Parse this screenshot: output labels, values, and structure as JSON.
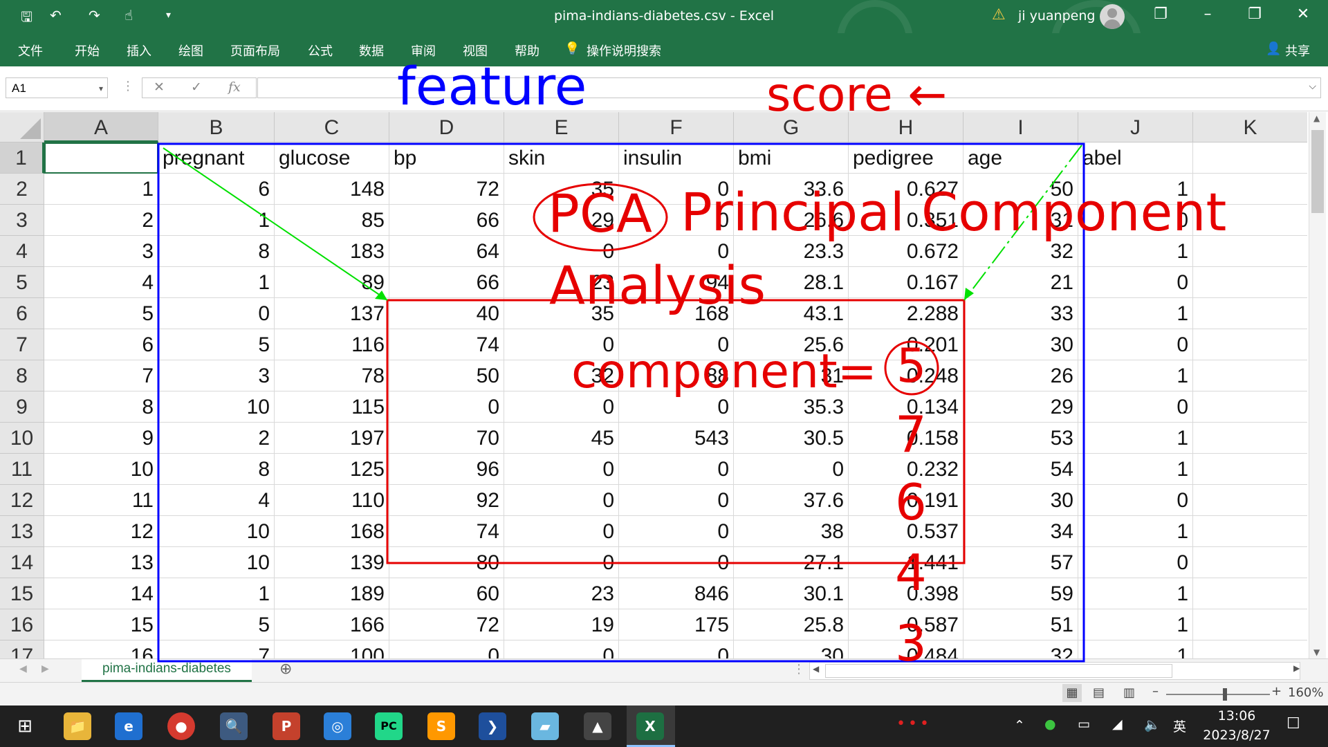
{
  "window": {
    "title": "pima-indians-diabetes.csv  -  Excel",
    "user": "ji yuanpeng",
    "warning_icon": "warning-icon",
    "theme_color": "#217346"
  },
  "ribbon": {
    "tabs": [
      "文件",
      "开始",
      "插入",
      "绘图",
      "页面布局",
      "公式",
      "数据",
      "审阅",
      "视图",
      "帮助"
    ],
    "search": "操作说明搜索",
    "share": "共享"
  },
  "formula_bar": {
    "name_box": "A1",
    "fx_label": "fx",
    "formula": ""
  },
  "columns": [
    "A",
    "B",
    "C",
    "D",
    "E",
    "F",
    "G",
    "H",
    "I",
    "J",
    "K"
  ],
  "header_row": [
    "",
    "pregnant",
    "glucose",
    "bp",
    "skin",
    "insulin",
    "bmi",
    "pedigree",
    "age",
    "abel",
    ""
  ],
  "rows": [
    [
      "1",
      "6",
      "148",
      "72",
      "35",
      "0",
      "33.6",
      "0.627",
      "50",
      "1"
    ],
    [
      "2",
      "1",
      "85",
      "66",
      "29",
      "0",
      "26.6",
      "0.351",
      "31",
      "0"
    ],
    [
      "3",
      "8",
      "183",
      "64",
      "0",
      "0",
      "23.3",
      "0.672",
      "32",
      "1"
    ],
    [
      "4",
      "1",
      "89",
      "66",
      "23",
      "94",
      "28.1",
      "0.167",
      "21",
      "0"
    ],
    [
      "5",
      "0",
      "137",
      "40",
      "35",
      "168",
      "43.1",
      "2.288",
      "33",
      "1"
    ],
    [
      "6",
      "5",
      "116",
      "74",
      "0",
      "0",
      "25.6",
      "0.201",
      "30",
      "0"
    ],
    [
      "7",
      "3",
      "78",
      "50",
      "32",
      "88",
      "31",
      "0.248",
      "26",
      "1"
    ],
    [
      "8",
      "10",
      "115",
      "0",
      "0",
      "0",
      "35.3",
      "0.134",
      "29",
      "0"
    ],
    [
      "9",
      "2",
      "197",
      "70",
      "45",
      "543",
      "30.5",
      "0.158",
      "53",
      "1"
    ],
    [
      "10",
      "8",
      "125",
      "96",
      "0",
      "0",
      "0",
      "0.232",
      "54",
      "1"
    ],
    [
      "11",
      "4",
      "110",
      "92",
      "0",
      "0",
      "37.6",
      "0.191",
      "30",
      "0"
    ],
    [
      "12",
      "10",
      "168",
      "74",
      "0",
      "0",
      "38",
      "0.537",
      "34",
      "1"
    ],
    [
      "13",
      "10",
      "139",
      "80",
      "0",
      "0",
      "27.1",
      "1.441",
      "57",
      "0"
    ],
    [
      "14",
      "1",
      "189",
      "60",
      "23",
      "846",
      "30.1",
      "0.398",
      "59",
      "1"
    ],
    [
      "15",
      "5",
      "166",
      "72",
      "19",
      "175",
      "25.8",
      "0.587",
      "51",
      "1"
    ],
    [
      "16",
      "7",
      "100",
      "0",
      "0",
      "0",
      "30",
      "0.484",
      "32",
      "1"
    ]
  ],
  "row_numbers": [
    "1",
    "2",
    "3",
    "4",
    "5",
    "6",
    "7",
    "8",
    "9",
    "10",
    "11",
    "12",
    "13",
    "14",
    "15",
    "16",
    "17"
  ],
  "sheet": {
    "tab_name": "pima-indians-diabetes",
    "add_icon": "plus-circle-icon"
  },
  "status": {
    "zoom": "160%"
  },
  "annotations": {
    "feature": "feature",
    "score": "score ←",
    "pca": "PCA",
    "principal_component": "Principal Component",
    "analysis": "Analysis",
    "component_eq": "component=",
    "component_val": "5",
    "seven": "7",
    "six": "6",
    "four": "4",
    "three": "3",
    "blue": "#0000ff",
    "red": "#e60000",
    "green": "#00e000"
  },
  "taskbar": {
    "time": "13:06",
    "date": "2023/8/27",
    "ime": "英"
  }
}
